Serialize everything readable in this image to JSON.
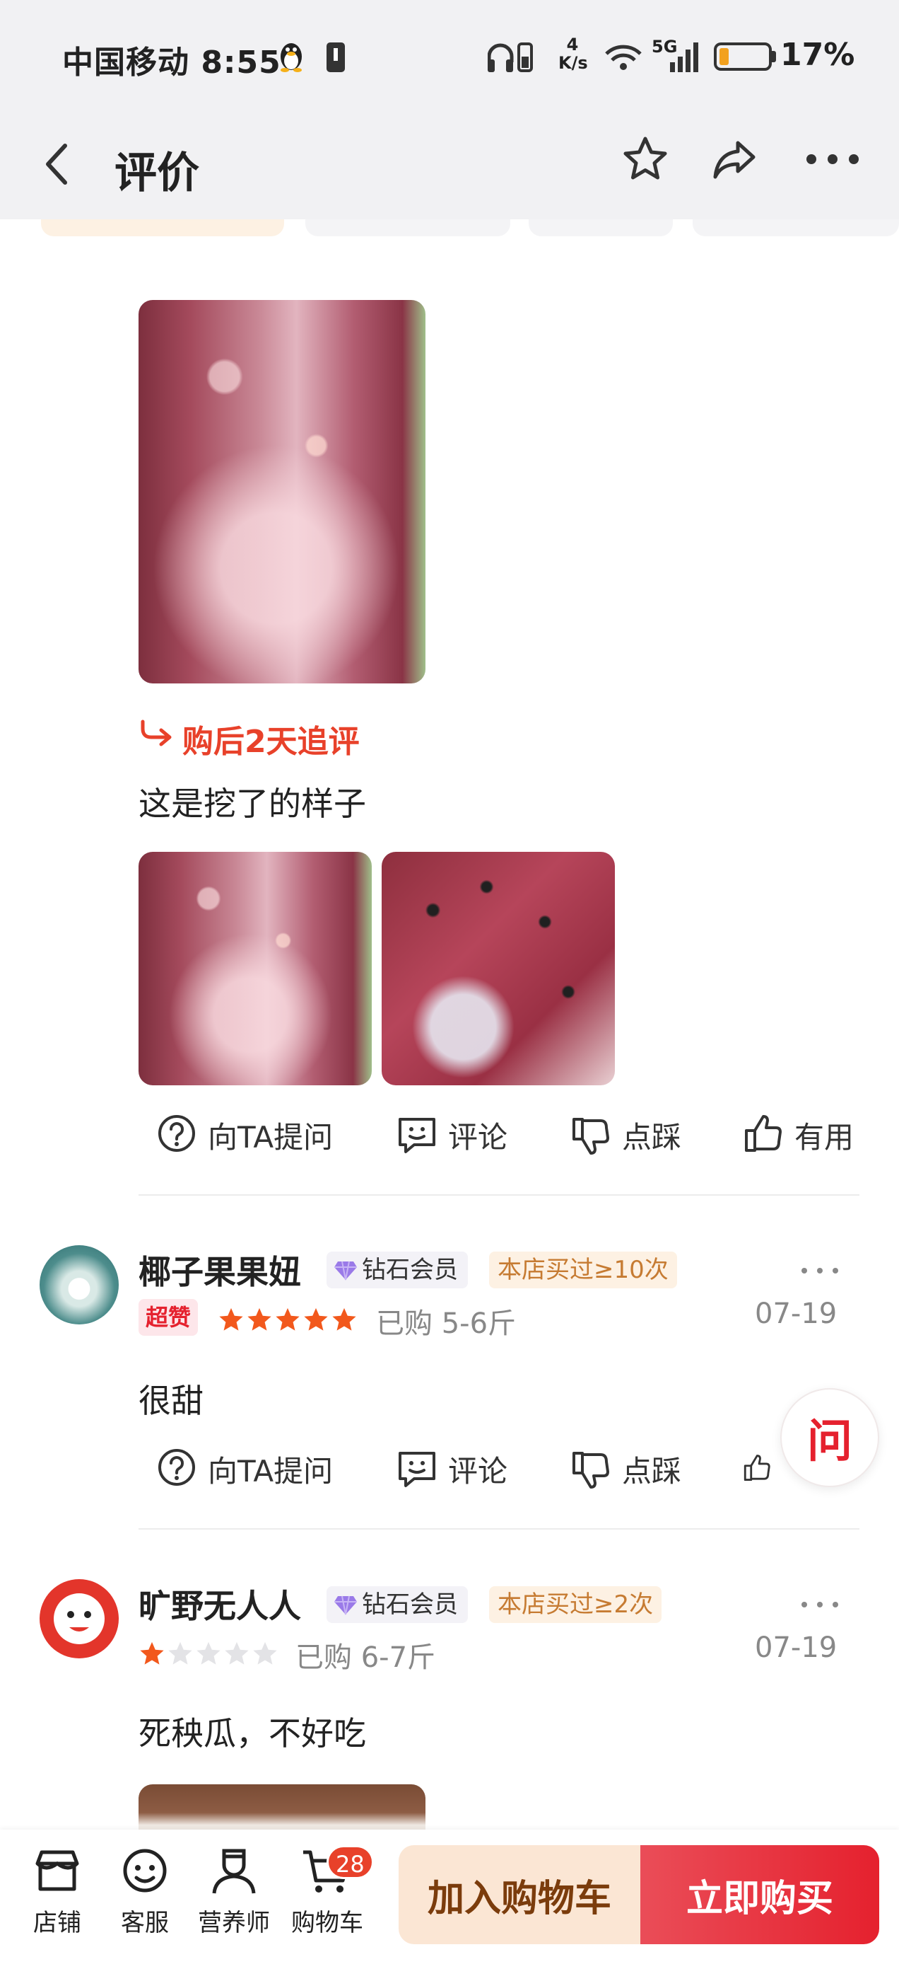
{
  "status_bar": {
    "carrier_time": "中国移动 8:55",
    "speed_top": "4",
    "speed_bottom": "K/s",
    "network": "5G",
    "battery_percent": "17%",
    "battery_level": 0.17,
    "battery_color": "#f2a11f"
  },
  "nav": {
    "title": "评价",
    "back_icon": "chevron-left-icon",
    "star_icon": "star-outline-icon",
    "share_icon": "share-icon",
    "more_icon": "more-dots-icon"
  },
  "review_1": {
    "followup_label": "购后2天追评",
    "followup_text": "这是挖了的样子",
    "actions": {
      "ask": "向TA提问",
      "comment": "评论",
      "dislike": "点踩",
      "useful": "有用"
    }
  },
  "review_2": {
    "username": "椰子果果妞",
    "member_badge": "钻石会员",
    "buy_badge": "本店买过≥10次",
    "super_badge": "超赞",
    "rating": 5,
    "purchase": "已购 5-6斤",
    "date": "07-19",
    "text": "很甜",
    "actions": {
      "ask": "向TA提问",
      "comment": "评论",
      "dislike": "点踩",
      "useful": "有用"
    }
  },
  "review_3": {
    "username": "旷野无人人",
    "member_badge": "钻石会员",
    "buy_badge": "本店买过≥2次",
    "rating": 1,
    "purchase": "已购 6-7斤",
    "date": "07-19",
    "text": "死秧瓜，不好吃"
  },
  "ask_float": "问",
  "bottom_bar": {
    "store": "店铺",
    "service": "客服",
    "nutritionist": "营养师",
    "cart": "购物车",
    "cart_count": "28",
    "add_to_cart": "加入购物车",
    "buy_now": "立即购买"
  },
  "colors": {
    "accent_red": "#e5212e",
    "followup_red": "#e8412a",
    "star_orange": "#f2581c",
    "buy_badge_text": "#c67b32"
  }
}
